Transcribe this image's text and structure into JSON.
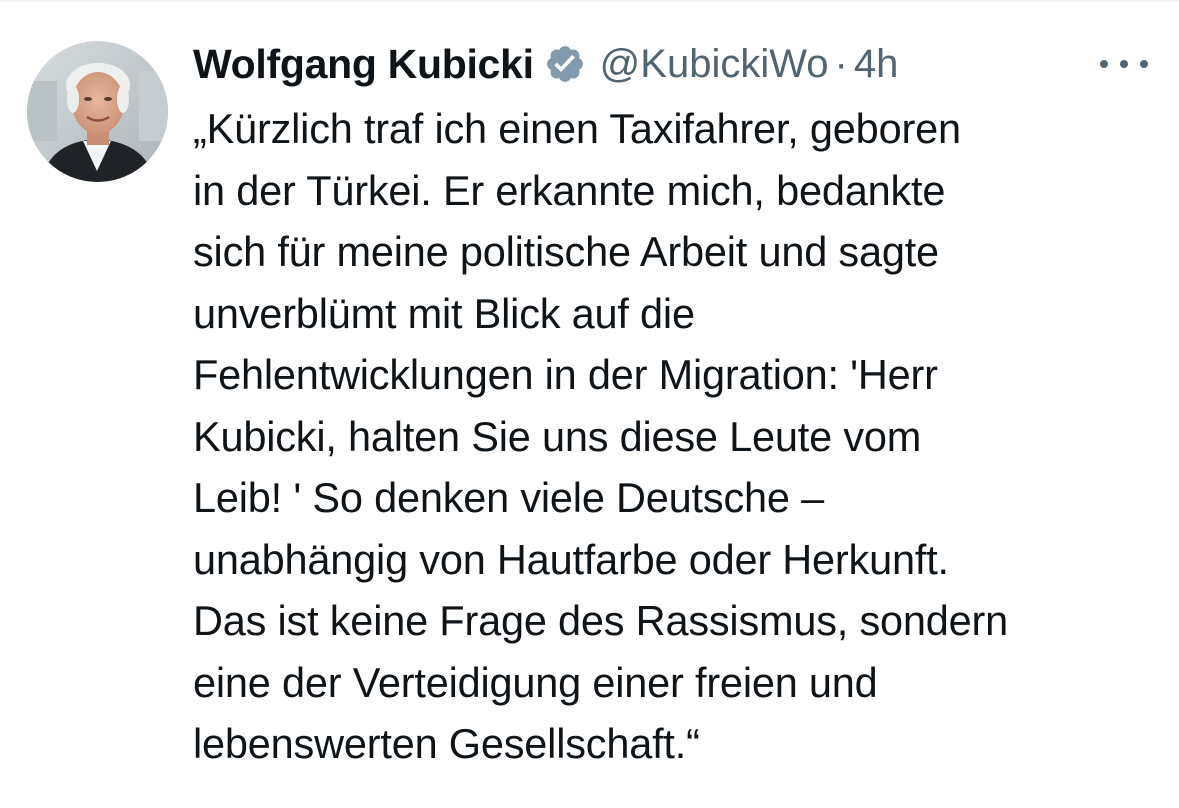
{
  "tweet": {
    "author": {
      "name": "Wolfgang Kubicki",
      "handle": "@KubickiWo",
      "verified_icon": "verified-badge-icon"
    },
    "separator": "·",
    "time": "4h",
    "more_icon": "more-horizontal-icon",
    "text_lines": [
      "„Kürzlich traf ich einen Taxifahrer, geboren",
      "in der Türkei. Er erkannte mich, bedankte",
      "sich für meine politische Arbeit und sagte",
      "unverblümt mit Blick auf die",
      "Fehlentwicklungen in der Migration: 'Herr",
      "Kubicki, halten Sie uns diese Leute vom",
      "Leib! ' So denken viele Deutsche –",
      "unabhängig von Hautfarbe oder Herkunft.",
      "Das ist keine Frage des Rassismus, sondern",
      "eine der Verteidigung einer freien und",
      "lebenswerten Gesellschaft.“"
    ]
  },
  "colors": {
    "text_primary": "#0f1419",
    "text_secondary": "#536471",
    "verified_badge": "#829aab",
    "divider": "#eff3f4"
  }
}
